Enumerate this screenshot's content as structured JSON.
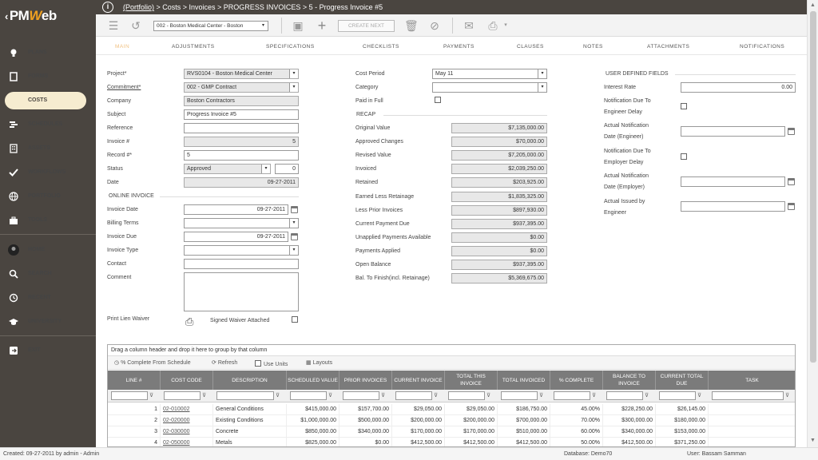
{
  "app": {
    "logo_text": "PMWeb"
  },
  "sidebar": {
    "items": [
      {
        "label": "PLANS",
        "icon": "bulb-icon"
      },
      {
        "label": "FORMS",
        "icon": "document-icon"
      },
      {
        "label": "COSTS",
        "icon": "cost-icon",
        "active": true
      },
      {
        "label": "SCHEDULES",
        "icon": "schedule-icon"
      },
      {
        "label": "ASSETS",
        "icon": "building-icon"
      },
      {
        "label": "WORKFLOWS",
        "icon": "check-icon"
      },
      {
        "label": "PORTFOLIO",
        "icon": "globe-icon"
      },
      {
        "label": "TOOLS",
        "icon": "toolbox-icon"
      },
      {
        "label": "HOME",
        "icon": "avatar-icon"
      },
      {
        "label": "SEARCH",
        "icon": "search-icon"
      },
      {
        "label": "RECENT",
        "icon": "recent-icon"
      },
      {
        "label": "UNIVERSITY",
        "icon": "graduation-icon"
      },
      {
        "label": "EXIT",
        "icon": "exit-icon"
      }
    ]
  },
  "titlebar": {
    "portfolio": "(Portfolio)",
    "crumb": " > Costs > Invoices > PROGRESS INVOICES > 5 - Progress Invoice #5"
  },
  "toolbar": {
    "record_select": "002 - Boston Medical Center - Boston",
    "create_next": "CREATE NEXT"
  },
  "tabs": [
    "MAIN",
    "ADJUSTMENTS",
    "SPECIFICATIONS",
    "CHECKLISTS",
    "PAYMENTS",
    "CLAUSES",
    "NOTES",
    "ATTACHMENTS",
    "NOTIFICATIONS"
  ],
  "form": {
    "col1": {
      "project_label": "Project*",
      "project_value": "RVS0104 - Boston Medical Center",
      "commitment_label": "Commitment*",
      "commitment_value": "002 - GMP Contract",
      "company_label": "Company",
      "company_value": "Boston Contractors",
      "subject_label": "Subject",
      "subject_value": "Progress Invoice #5",
      "reference_label": "Reference",
      "reference_value": "",
      "invoice_no_label": "Invoice #",
      "invoice_no_value": "5",
      "record_no_label": "Record #*",
      "record_no_value": "5",
      "status_label": "Status",
      "status_value": "Approved",
      "status_num": "0",
      "date_label": "Date",
      "date_value": "09-27-2011",
      "online_section": "ONLINE INVOICE",
      "invoice_date_label": "Invoice Date",
      "invoice_date_value": "09-27-2011",
      "billing_terms_label": "Billing Terms",
      "billing_terms_value": "",
      "invoice_due_label": "Invoice Due",
      "invoice_due_value": "09-27-2011",
      "invoice_type_label": "Invoice Type",
      "invoice_type_value": "",
      "contact_label": "Contact",
      "contact_value": "",
      "comment_label": "Comment",
      "print_lien_label": "Print Lien Waiver",
      "signed_waiver_label": "Signed Waiver Attached"
    },
    "col2": {
      "cost_period_label": "Cost Period",
      "cost_period_value": "May 11",
      "category_label": "Category",
      "category_value": "",
      "paid_in_full_label": "Paid in Full",
      "recap_section": "RECAP",
      "recap": [
        {
          "label": "Original Value",
          "value": "$7,135,000.00"
        },
        {
          "label": "Approved Changes",
          "value": "$70,000.00"
        },
        {
          "label": "Revised Value",
          "value": "$7,205,000.00"
        },
        {
          "label": "Invoiced",
          "value": "$2,039,250.00"
        },
        {
          "label": "Retained",
          "value": "$203,925.00"
        },
        {
          "label": "Earned Less Retainage",
          "value": "$1,835,325.00"
        },
        {
          "label": "Less Prior Invoices",
          "value": "$897,930.00"
        },
        {
          "label": "Current Payment Due",
          "value": "$937,395.00"
        },
        {
          "label": "Unapplied Payments Available",
          "value": "$0.00"
        },
        {
          "label": "Payments Applied",
          "value": "$0.00"
        },
        {
          "label": "Open Balance",
          "value": "$937,395.00"
        },
        {
          "label": "Bal. To Finish(incl. Retainage)",
          "value": "$5,369,675.00"
        }
      ]
    },
    "col3": {
      "udf_section": "USER DEFINED FIELDS",
      "interest_rate_label": "Interest Rate",
      "interest_rate_value": "0.00",
      "notif_eng_label1": "Notification Due To",
      "notif_eng_label2": "Engineer Delay",
      "actual_notif_eng_label1": "Actual Notification",
      "actual_notif_eng_label2": "Date (Engineer)",
      "notif_emp_label1": "Notification Due To",
      "notif_emp_label2": "Employer Delay",
      "actual_notif_emp_label1": "Actual Notification",
      "actual_notif_emp_label2": "Date (Employer)",
      "actual_issued_label1": "Actual Issued by",
      "actual_issued_label2": "Engineer"
    }
  },
  "grid": {
    "group_hint": "Drag a column header and drop it here to group by that column",
    "toolbar": {
      "pct_complete": "% Complete From Schedule",
      "refresh": "Refresh",
      "use_units": "Use Units",
      "layouts": "Layouts"
    },
    "columns": [
      "LINE #",
      "COST CODE",
      "DESCRIPTION",
      "SCHEDULED VALUE",
      "PRIOR INVOICES",
      "CURRENT INVOICE",
      "TOTAL THIS INVOICE",
      "TOTAL INVOICED",
      "% COMPLETE",
      "BALANCE TO INVOICE",
      "CURRENT TOTAL DUE",
      "TASK"
    ],
    "rows": [
      [
        "1",
        "02-010002",
        "General Conditions",
        "$415,000.00",
        "$157,700.00",
        "$29,050.00",
        "$29,050.00",
        "$186,750.00",
        "45.00%",
        "$228,250.00",
        "$26,145.00",
        ""
      ],
      [
        "2",
        "02-020000",
        "Existing Conditions",
        "$1,000,000.00",
        "$500,000.00",
        "$200,000.00",
        "$200,000.00",
        "$700,000.00",
        "70.00%",
        "$300,000.00",
        "$180,000.00",
        ""
      ],
      [
        "3",
        "02-030000",
        "Concrete",
        "$850,000.00",
        "$340,000.00",
        "$170,000.00",
        "$170,000.00",
        "$510,000.00",
        "60.00%",
        "$340,000.00",
        "$153,000.00",
        ""
      ],
      [
        "4",
        "02-050000",
        "Metals",
        "$825,000.00",
        "$0.00",
        "$412,500.00",
        "$412,500.00",
        "$412,500.00",
        "50.00%",
        "$412,500.00",
        "$371,250.00",
        ""
      ]
    ]
  },
  "status": {
    "created": "Created:  09-27-2011 by admin - Admin",
    "database": "Database:   Demo70",
    "user": "User:   Bassam Samman"
  }
}
